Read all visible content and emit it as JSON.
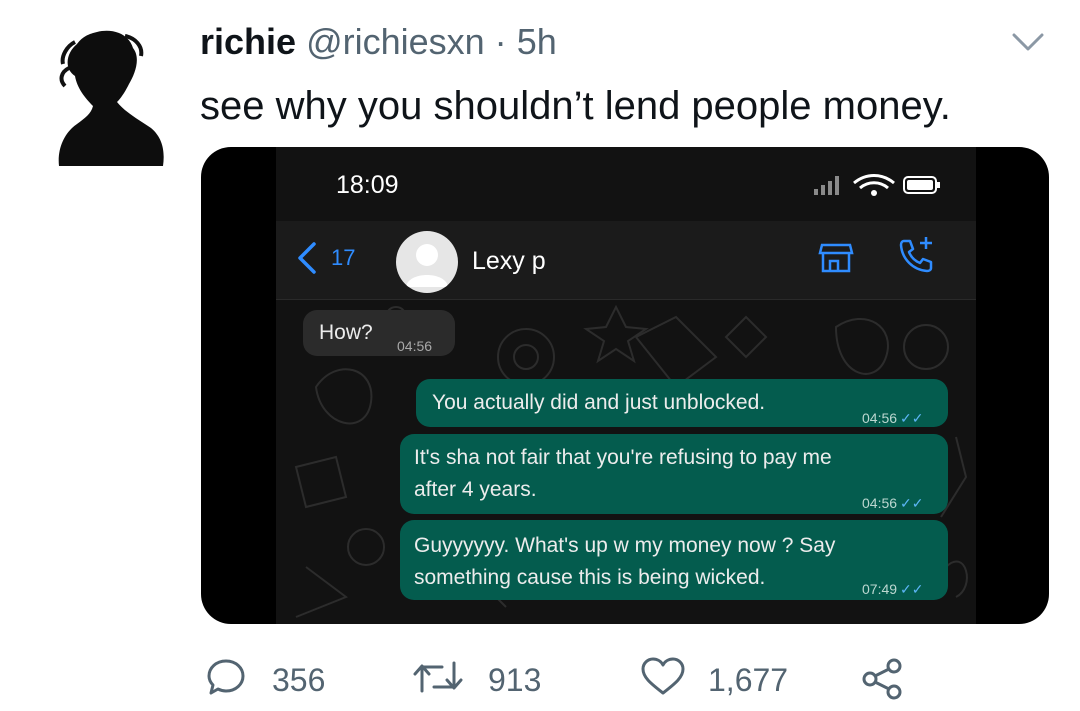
{
  "tweet": {
    "author_name": "richie",
    "author_handle": "@richiesxn",
    "separator": "·",
    "time": "5h",
    "text": "see why you shouldn’t lend people money."
  },
  "screenshot": {
    "status_time": "18:09",
    "back_count": "17",
    "contact_name": "Lexy p",
    "messages": [
      {
        "direction": "incoming",
        "text": "How?",
        "time": "04:56"
      },
      {
        "direction": "outgoing",
        "text": "You actually did and just unblocked.",
        "time": "04:56",
        "ticks": "✓✓"
      },
      {
        "direction": "outgoing",
        "text_line1": "It's sha not fair that you're refusing to pay me",
        "text_line2": "after 4 years.",
        "time": "04:56",
        "ticks": "✓✓"
      },
      {
        "direction": "outgoing",
        "text_line1": "Guyyyyyy. What's up w my money now ? Say",
        "text_line2": "something cause this is being wicked.",
        "time": "07:49",
        "ticks": "✓✓"
      }
    ]
  },
  "actions": {
    "replies": "356",
    "retweets": "913",
    "likes": "1,677"
  },
  "colors": {
    "handle_gray": "#536471",
    "outgoing_bubble": "#045c4e",
    "incoming_bubble": "#2b2b2b",
    "ios_blue": "#2f8cff"
  }
}
